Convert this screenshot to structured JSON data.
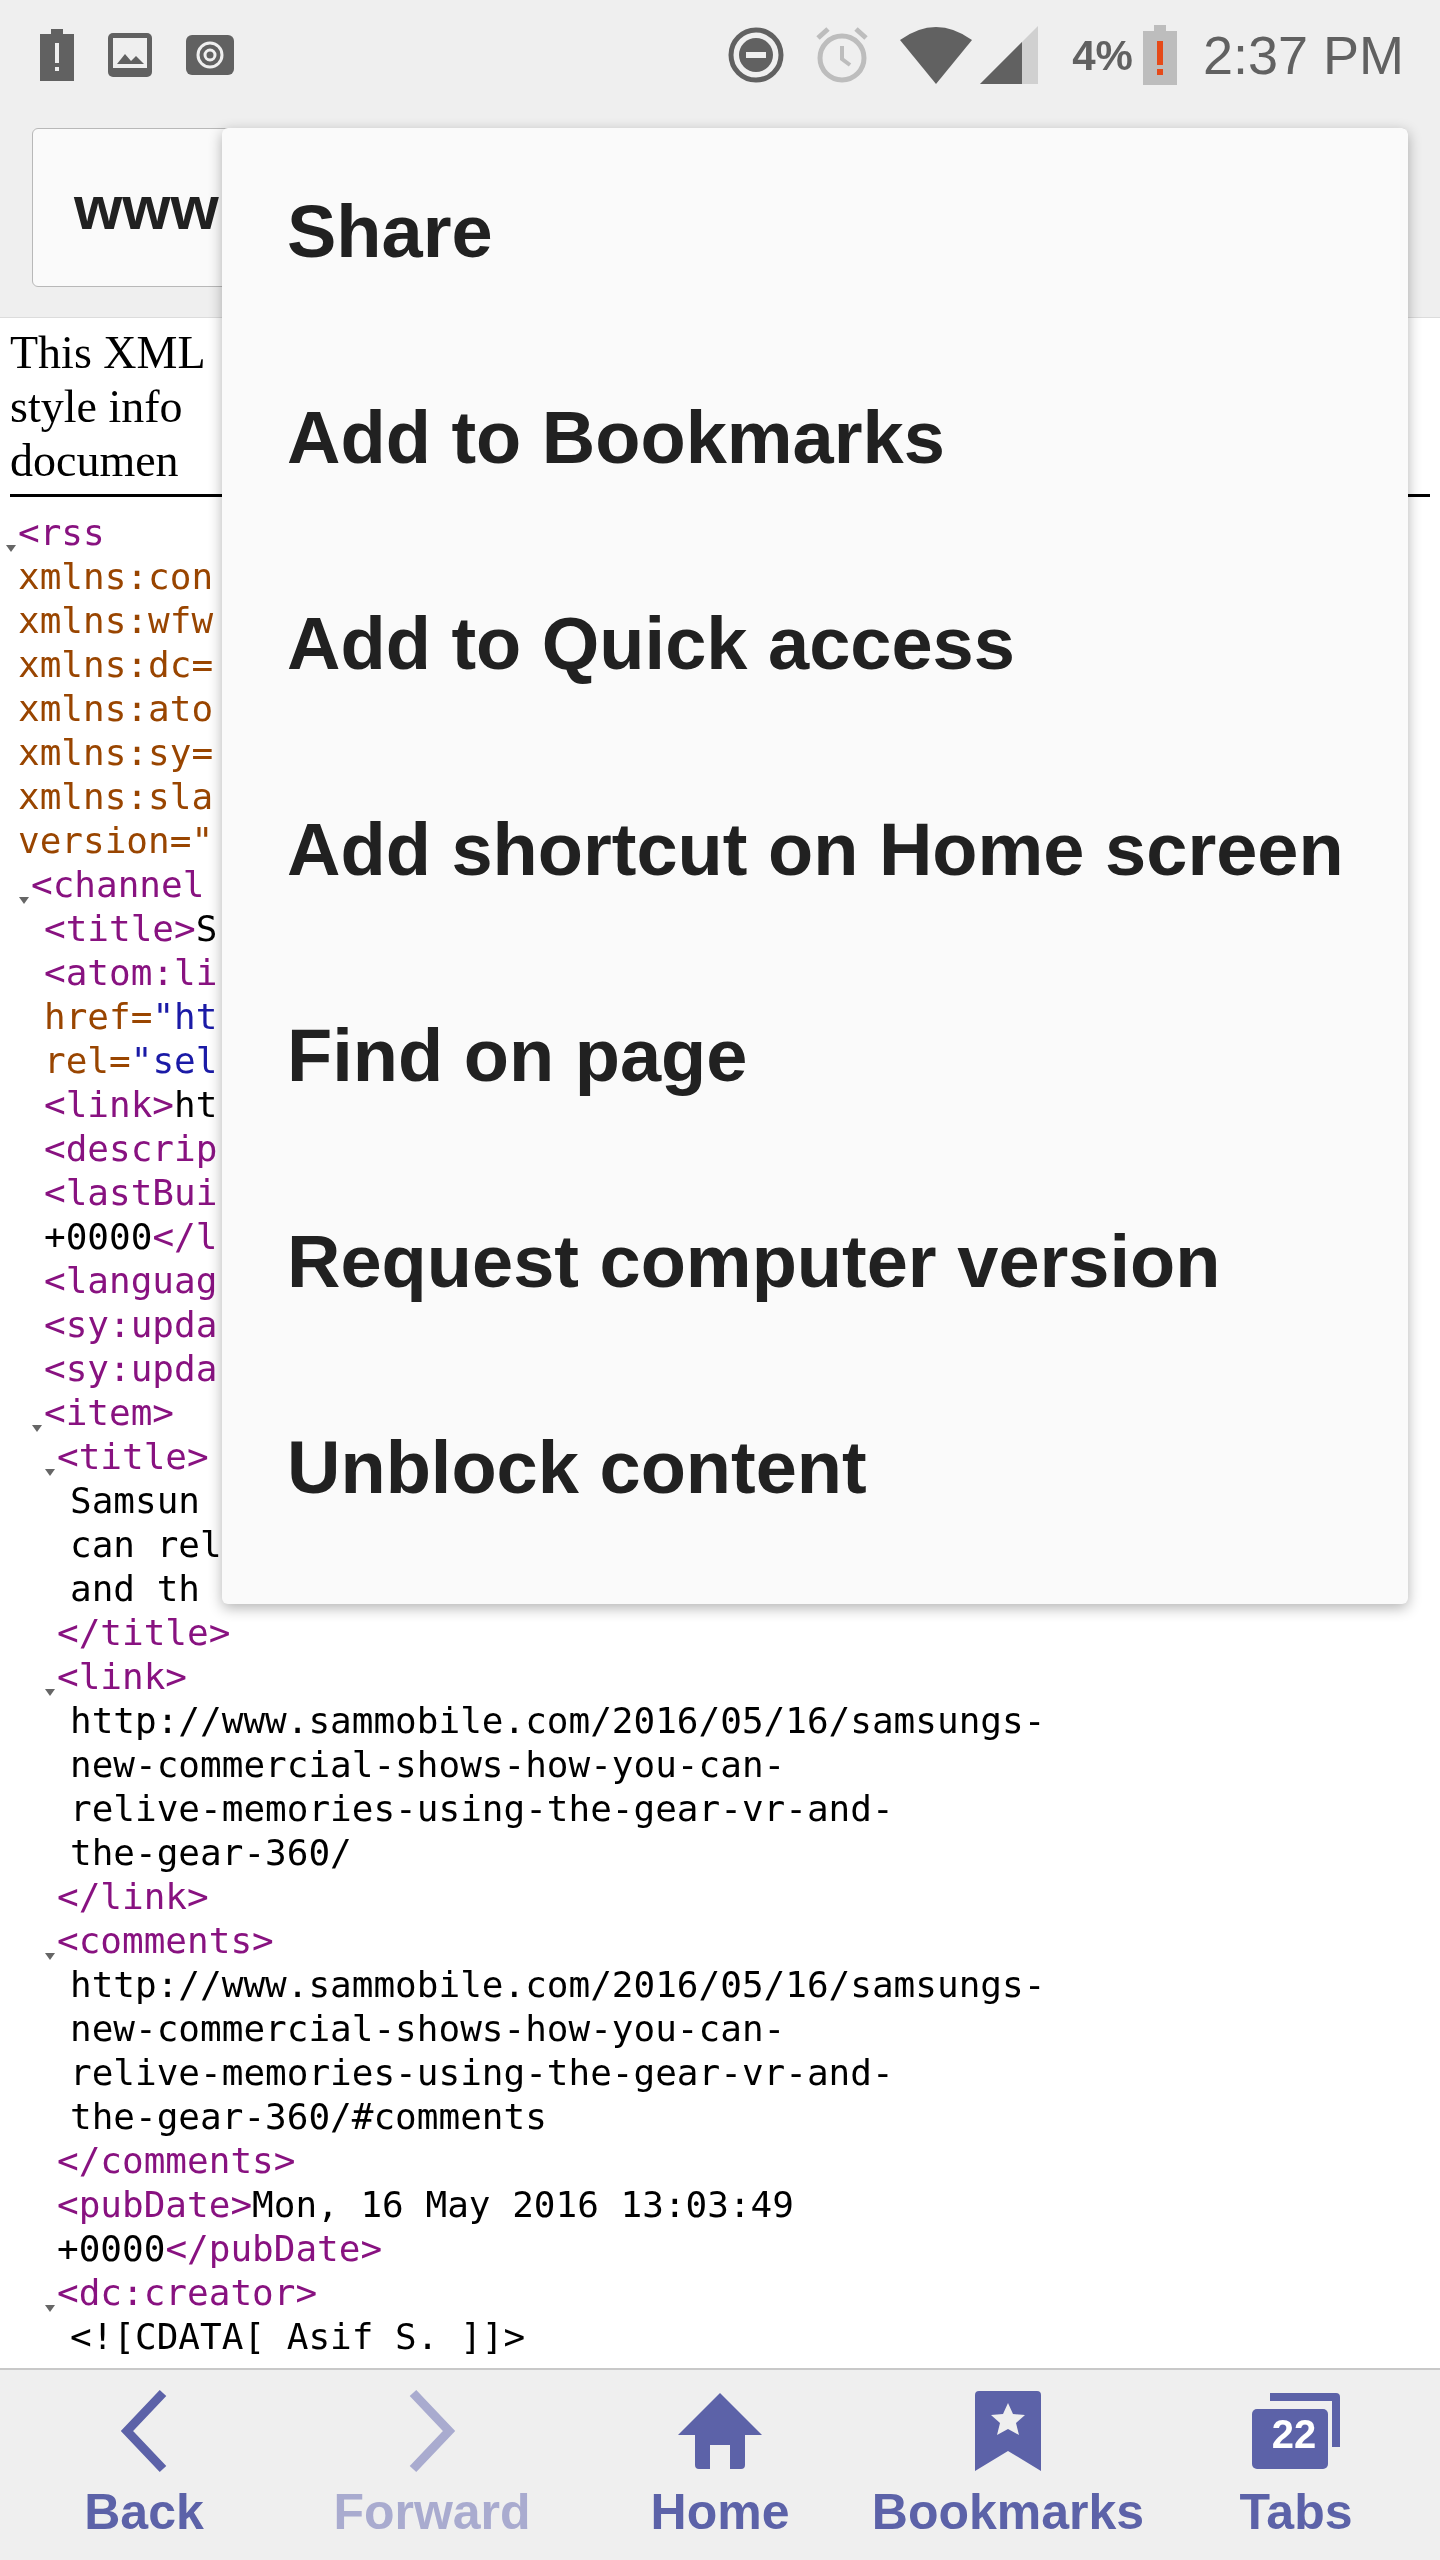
{
  "status_bar": {
    "battery": "4%",
    "time": "2:37 PM"
  },
  "address_bar": {
    "value": "www"
  },
  "xml_notice": {
    "lines": [
      "This XML",
      "style info",
      "documen"
    ]
  },
  "xml_tree": [
    {
      "expanded": true,
      "lines": [
        [
          {
            "kind": "tag",
            "text": "<rss"
          }
        ],
        [
          {
            "kind": "attr",
            "text": "xmlns:con"
          }
        ],
        [
          {
            "kind": "attr",
            "text": "xmlns:wfw"
          }
        ],
        [
          {
            "kind": "attr",
            "text": "xmlns:dc="
          }
        ],
        [
          {
            "kind": "attr",
            "text": "xmlns:ato"
          }
        ],
        [
          {
            "kind": "attr",
            "text": "xmlns:sy="
          }
        ],
        [
          {
            "kind": "attr",
            "text": "xmlns:sla"
          }
        ],
        [
          {
            "kind": "attr",
            "text": "version=\""
          }
        ]
      ],
      "children": [
        {
          "expanded": true,
          "lines": [
            [
              {
                "kind": "tag",
                "text": "<channel"
              }
            ]
          ],
          "children": [
            {
              "lines": [
                [
                  {
                    "kind": "tag",
                    "text": "<title>"
                  },
                  {
                    "kind": "text",
                    "text": "S"
                  }
                ]
              ]
            },
            {
              "lines": [
                [
                  {
                    "kind": "tag",
                    "text": "<atom:li"
                  }
                ],
                [
                  {
                    "kind": "attr",
                    "text": "href="
                  },
                  {
                    "kind": "value",
                    "text": "\"ht"
                  }
                ],
                [
                  {
                    "kind": "attr",
                    "text": "rel="
                  },
                  {
                    "kind": "value",
                    "text": "\"sel"
                  }
                ]
              ]
            },
            {
              "lines": [
                [
                  {
                    "kind": "tag",
                    "text": "<link>"
                  },
                  {
                    "kind": "text",
                    "text": "ht"
                  }
                ]
              ]
            },
            {
              "lines": [
                [
                  {
                    "kind": "tag",
                    "text": "<descrip"
                  }
                ]
              ]
            },
            {
              "lines": [
                [
                  {
                    "kind": "tag",
                    "text": "<lastBui"
                  }
                ],
                [
                  {
                    "kind": "text",
                    "text": "+0000"
                  },
                  {
                    "kind": "tag",
                    "text": "</l"
                  }
                ]
              ]
            },
            {
              "lines": [
                [
                  {
                    "kind": "tag",
                    "text": "<languag"
                  }
                ]
              ]
            },
            {
              "lines": [
                [
                  {
                    "kind": "tag",
                    "text": "<sy:upda"
                  }
                ]
              ]
            },
            {
              "lines": [
                [
                  {
                    "kind": "tag",
                    "text": "<sy:upda"
                  }
                ]
              ]
            },
            {
              "expanded": true,
              "lines": [
                [
                  {
                    "kind": "tag",
                    "text": "<item>"
                  }
                ]
              ],
              "children": [
                {
                  "expanded": true,
                  "lines": [
                    [
                      {
                        "kind": "tag",
                        "text": "<title>"
                      }
                    ]
                  ],
                  "children": [
                    {
                      "lines": [
                        [
                          {
                            "kind": "text",
                            "text": "Samsun"
                          }
                        ],
                        [
                          {
                            "kind": "text",
                            "text": "can rel"
                          }
                        ],
                        [
                          {
                            "kind": "text",
                            "text": "and th"
                          }
                        ]
                      ]
                    }
                  ],
                  "end": [
                    [
                      {
                        "kind": "tag",
                        "text": "</title>"
                      }
                    ]
                  ]
                },
                {
                  "expanded": true,
                  "lines": [
                    [
                      {
                        "kind": "tag",
                        "text": "<link>"
                      }
                    ]
                  ],
                  "children": [
                    {
                      "lines": [
                        [
                          {
                            "kind": "text",
                            "text": "http://www.sammobile.com/2016/05/16/samsungs-"
                          }
                        ],
                        [
                          {
                            "kind": "text",
                            "text": "new-commercial-shows-how-you-can-"
                          }
                        ],
                        [
                          {
                            "kind": "text",
                            "text": "relive-memories-using-the-gear-vr-and-"
                          }
                        ],
                        [
                          {
                            "kind": "text",
                            "text": "the-gear-360/"
                          }
                        ]
                      ]
                    }
                  ],
                  "end": [
                    [
                      {
                        "kind": "tag",
                        "text": "</link>"
                      }
                    ]
                  ]
                },
                {
                  "expanded": true,
                  "lines": [
                    [
                      {
                        "kind": "tag",
                        "text": "<comments>"
                      }
                    ]
                  ],
                  "children": [
                    {
                      "lines": [
                        [
                          {
                            "kind": "text",
                            "text": "http://www.sammobile.com/2016/05/16/samsungs-"
                          }
                        ],
                        [
                          {
                            "kind": "text",
                            "text": "new-commercial-shows-how-you-can-"
                          }
                        ],
                        [
                          {
                            "kind": "text",
                            "text": "relive-memories-using-the-gear-vr-and-"
                          }
                        ],
                        [
                          {
                            "kind": "text",
                            "text": "the-gear-360/#comments"
                          }
                        ]
                      ]
                    }
                  ],
                  "end": [
                    [
                      {
                        "kind": "tag",
                        "text": "</comments>"
                      }
                    ]
                  ]
                },
                {
                  "lines": [
                    [
                      {
                        "kind": "tag",
                        "text": "<pubDate>"
                      },
                      {
                        "kind": "text",
                        "text": "Mon, 16 May 2016 13:03:49"
                      }
                    ],
                    [
                      {
                        "kind": "text",
                        "text": "+0000"
                      },
                      {
                        "kind": "tag",
                        "text": "</pubDate>"
                      }
                    ]
                  ]
                },
                {
                  "expanded": true,
                  "lines": [
                    [
                      {
                        "kind": "tag",
                        "text": "<dc:creator>"
                      }
                    ]
                  ],
                  "children": [
                    {
                      "lines": [
                        [
                          {
                            "kind": "text",
                            "text": "<![CDATA[ Asif S. ]]>"
                          }
                        ]
                      ]
                    }
                  ]
                }
              ]
            }
          ]
        }
      ]
    }
  ],
  "menu": {
    "items": [
      "Share",
      "Add to Bookmarks",
      "Add to Quick access",
      "Add shortcut on Home screen",
      "Find on page",
      "Request computer version",
      "Unblock content"
    ]
  },
  "bottom_nav": [
    {
      "label": "Back",
      "disabled": false
    },
    {
      "label": "Forward",
      "disabled": true
    },
    {
      "label": "Home",
      "disabled": false
    },
    {
      "label": "Bookmarks",
      "disabled": false
    },
    {
      "label": "Tabs",
      "disabled": false,
      "count": "22"
    }
  ]
}
